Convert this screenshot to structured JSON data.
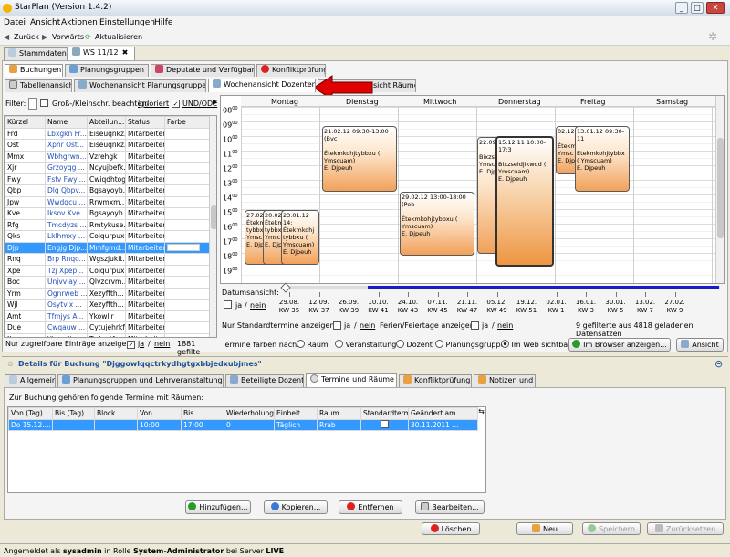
{
  "window": {
    "title": "StarPlan (Version 1.4.2)"
  },
  "menu": [
    "Datei",
    "Ansicht",
    "Aktionen",
    "Einstellungen",
    "Hilfe"
  ],
  "nav": {
    "back": "Zurück",
    "forward": "Vorwärts",
    "refresh": "Aktualisieren"
  },
  "top_tabs": [
    "Stammdaten",
    "WS 11/12"
  ],
  "main_tabs": [
    "Buchungen",
    "Planungsgruppen",
    "Deputate und Verfügbarkeit",
    "Konfliktprüfung"
  ],
  "view_tabs": [
    "Tabellenansicht",
    "Wochenansicht Planungsgruppen",
    "Wochenansicht Dozenten",
    "Wochenansicht Räume"
  ],
  "view_tab_partial": "sicht Räume",
  "filter": {
    "label": "Filter:",
    "case_label": "Groß-/Kleinschr. beachten/",
    "ignore": "ignoriert",
    "andor": "UND/ODE"
  },
  "table": {
    "columns": [
      "Kürzel",
      "Name",
      "Abteilun...",
      "Status",
      "Farbe"
    ],
    "rows": [
      [
        "Frd",
        "Lbxgkn Fr...",
        "Eiseuqnkz...",
        "Mitarbeiter"
      ],
      [
        "Ost",
        "Xphr Ost...",
        "Eiseuqnkz...",
        "Mitarbeiter"
      ],
      [
        "Mmx",
        "Wbhgrwn...",
        "Vzrehgk",
        "Mitarbeiter"
      ],
      [
        "Xjr",
        "Grzoyqg ...",
        "Ncyujbefk...",
        "Mitarbeiter"
      ],
      [
        "Fwy",
        "Fsfv Fwyl...",
        "Cwiqdhtog...",
        "Mitarbeiter"
      ],
      [
        "Qbp",
        "Dlg Qbpv...",
        "Bgsayoyb...",
        "Mitarbeiter"
      ],
      [
        "Jpw",
        "Wwdqcu ...",
        "Rrwmxm...",
        "Mitarbeiter"
      ],
      [
        "Kve",
        "Iksov Kve...",
        "Bgsayoyb...",
        "Mitarbeiter"
      ],
      [
        "Rfg",
        "Tmcdyzs ...",
        "Rmtykuse...",
        "Mitarbeiter"
      ],
      [
        "Qks",
        "Lklhmxy ...",
        "Coiqurpux...",
        "Mitarbeiter"
      ],
      [
        "Djp",
        "Engjg Djp...",
        "Mmfgmd...",
        "Mitarbeiter"
      ],
      [
        "Rnq",
        "Brp Rnqo...",
        "Wgszjukit...",
        "Mitarbeiter"
      ],
      [
        "Xpe",
        "Tzj Xpep...",
        "Coiqurpux...",
        "Mitarbeiter"
      ],
      [
        "Boc",
        "Unjvvlay ...",
        "Qlvzcrvm...",
        "Mitarbeiter"
      ],
      [
        "Yrm",
        "Ognrweb ...",
        "Xezyffth...",
        "Mitarbeiter"
      ],
      [
        "Wjl",
        "Osytvix ...",
        "Xezyffth...",
        "Mitarbeiter"
      ],
      [
        "Amt",
        "Tfmjys A...",
        "Ykowlir",
        "Mitarbeiter"
      ],
      [
        "Due",
        "Cwqauw ...",
        "Cytujehrkf",
        "Mitarbeiter"
      ],
      [
        "Jku",
        "Ylpse Jku...",
        "Tyduutfs...",
        "Mitarbeiter"
      ],
      [
        "Iyk",
        "Mjtmrl Iy...",
        "Vzrehgk",
        "Mitarbeiter"
      ]
    ],
    "selected_row": 10
  },
  "table_footer": {
    "label": "Nur zugreifbare Einträge anzeigen:",
    "ja": "ja",
    "nein": "nein",
    "count": "1881 gefilte"
  },
  "calendar": {
    "days": [
      "Montag",
      "Dienstag",
      "Mittwoch",
      "Donnerstag",
      "Freitag",
      "Samstag"
    ],
    "hours": [
      "08",
      "09",
      "10",
      "11",
      "12",
      "13",
      "14",
      "15",
      "16",
      "17",
      "18",
      "19"
    ],
    "hour_sup": "00",
    "events": [
      {
        "head": "21.02.12 09:30-13:00 (Bvc",
        "name": "Étekmkohjtybbxu ( Ymscuam)",
        "who": "E. Djpeuh"
      },
      {
        "head": "29.02.12 13:00-18:00 (Peb",
        "name": "Étekmkohjtybbxu ( Ymscuam)",
        "who": "E. Djpeuh"
      },
      {
        "head": "22.09.",
        "name": "Bixzs Ymsc",
        "who": "E. Djp"
      },
      {
        "head": "15.12.11 10:00-17:3",
        "name": "Bixzseidjikwqd ( Ymscuam)",
        "who": "E. Djpeuh"
      },
      {
        "head": "02.12.",
        "name": "Étekm ( Ymsc",
        "who": "E. Djp"
      },
      {
        "head": "13.01.12 09:30-11",
        "name": "Étekmkohjtybbx ( Ymscuam)",
        "who": "E. Djpeuh"
      },
      {
        "head": "27.02.",
        "name": "Étekm tybbx ( Ymsc",
        "who": "E. Djp"
      },
      {
        "head": "20.02.",
        "name": "Étekm tybbx ( Ymsc",
        "who": "E. Djp"
      },
      {
        "head": "23.01.12 14:",
        "name": "Étekmkohj tybbxu ( Ymscuam)",
        "who": "E. Djpeuh"
      }
    ]
  },
  "timeline": {
    "label": "Datumsansicht:",
    "ja": "ja",
    "nein": "nein",
    "dates": [
      "29.08.",
      "12.09.",
      "26.09.",
      "10.10.",
      "24.10.",
      "07.11.",
      "21.11.",
      "05.12.",
      "19.12.",
      "02.01.",
      "16.01.",
      "30.01.",
      "13.02.",
      "27.02."
    ],
    "weeks": [
      "KW 35",
      "KW 37",
      "KW 39",
      "KW 41",
      "KW 43",
      "KW 45",
      "KW 47",
      "KW 49",
      "KW 51",
      "KW 1",
      "KW 3",
      "KW 5",
      "KW 7",
      "KW 9"
    ]
  },
  "standard_row": {
    "std_label": "Nur Standardtermine anzeigen:",
    "hol_label": "Ferien/Feiertage anzeigen",
    "ja": "ja",
    "nein": "nein",
    "count": "9 gefilterte aus 4818 geladenen Datensätzen"
  },
  "color_row": {
    "label": "Termine färben nach:",
    "options": [
      "Raum",
      "Veranstaltung",
      "Dozent",
      "Planungsgruppe",
      "Im Web sichtbar"
    ],
    "selected": 4,
    "browser_btn": "Im Browser anzeigen...",
    "view_btn": "Ansicht"
  },
  "details": {
    "title": "Details für Buchung \"Djggowlqqctrkydhgtgxbbjedxubjmes\""
  },
  "detail_tabs": [
    "Allgemein",
    "Planungsgruppen und Lehrveranstaltungen",
    "Beteiligte Dozenten",
    "Termine und Räume",
    "Konfliktprüfung",
    "Notizen und Tags"
  ],
  "termine": {
    "label": "Zur Buchung gehören folgende Termine mit Räumen:",
    "columns": [
      "Von (Tag)",
      "Bis (Tag)",
      "Block",
      "Von",
      "Bis",
      "Wiederholungen",
      "Einheit",
      "Raum",
      "Standardtermin",
      "Geändert am"
    ],
    "row": [
      "Do 15.12....",
      "",
      "",
      "10:00",
      "17:00",
      "0",
      "Täglich",
      "Rrab",
      "",
      "30.11.2011 ..."
    ]
  },
  "detail_buttons": [
    "Hinzufügen...",
    "Kopieren...",
    "Entfernen",
    "Bearbeiten..."
  ],
  "bottom_buttons": [
    "Löschen",
    "Neu",
    "Speichern",
    "Zurücksetzen"
  ],
  "status": {
    "prefix": "Angemeldet als ",
    "user": "sysadmin",
    "mid": " in Rolle ",
    "role": "System-Administrator",
    "mid2": " bei Server ",
    "server": "LIVE"
  },
  "colors": {
    "accent": "#3399ff",
    "selection": "#3399ff",
    "event": "#f1a15b",
    "arrow": "#e00000",
    "timeline_bar": "#1a1acc"
  }
}
